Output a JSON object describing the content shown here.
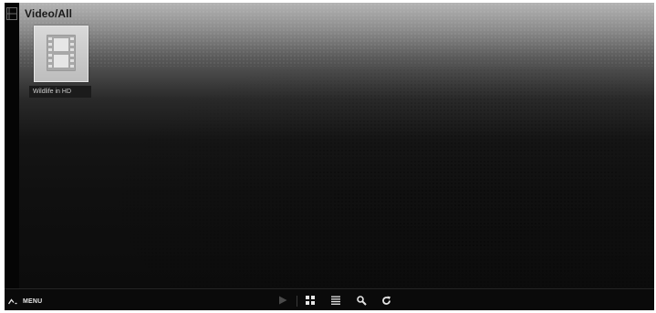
{
  "header": {
    "title": "Video/All"
  },
  "items": [
    {
      "label": "Wildlife in HD",
      "icon": "film-icon"
    }
  ],
  "toolbar": {
    "menu_label": "MENU",
    "menu_icon": "menu-chevron-icon",
    "buttons": [
      "play-icon",
      "grid-view-icon",
      "list-view-icon",
      "search-icon",
      "refresh-icon"
    ]
  },
  "colors": {
    "background_top": "#b3b3b3",
    "background_bottom": "#0c0c0c",
    "tile": "#cccccc",
    "bar": "#0a0a0a"
  }
}
